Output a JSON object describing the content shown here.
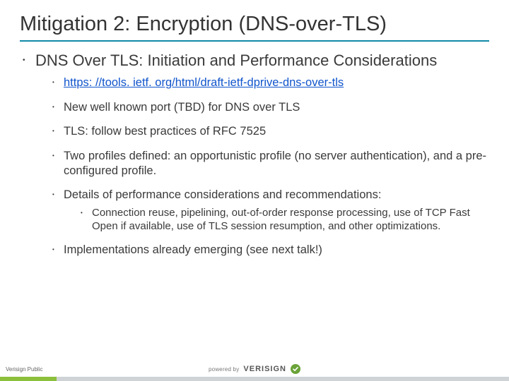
{
  "title": "Mitigation 2:  Encryption (DNS-over-TLS)",
  "l1": "DNS Over TLS: Initiation and Performance Considerations",
  "items": [
    {
      "text": "https: //tools. ietf. org/html/draft-ietf-dprive-dns-over-tls",
      "link": true
    },
    {
      "text": "New well known port (TBD) for DNS over TLS"
    },
    {
      "text": "TLS: follow best practices of RFC 7525"
    },
    {
      "text": "Two profiles defined: an opportunistic profile (no server authentication), and a pre-configured profile."
    },
    {
      "text": "Details of performance considerations and recommendations:",
      "sub": [
        "Connection reuse, pipelining, out-of-order response processing, use of TCP Fast Open if available, use of TLS session resumption, and other optimizations."
      ]
    },
    {
      "text": "Implementations already emerging (see next talk!)"
    }
  ],
  "footer": {
    "classification": "Verisign Public",
    "poweredby": "powered by",
    "brand": "VERISIGN"
  }
}
